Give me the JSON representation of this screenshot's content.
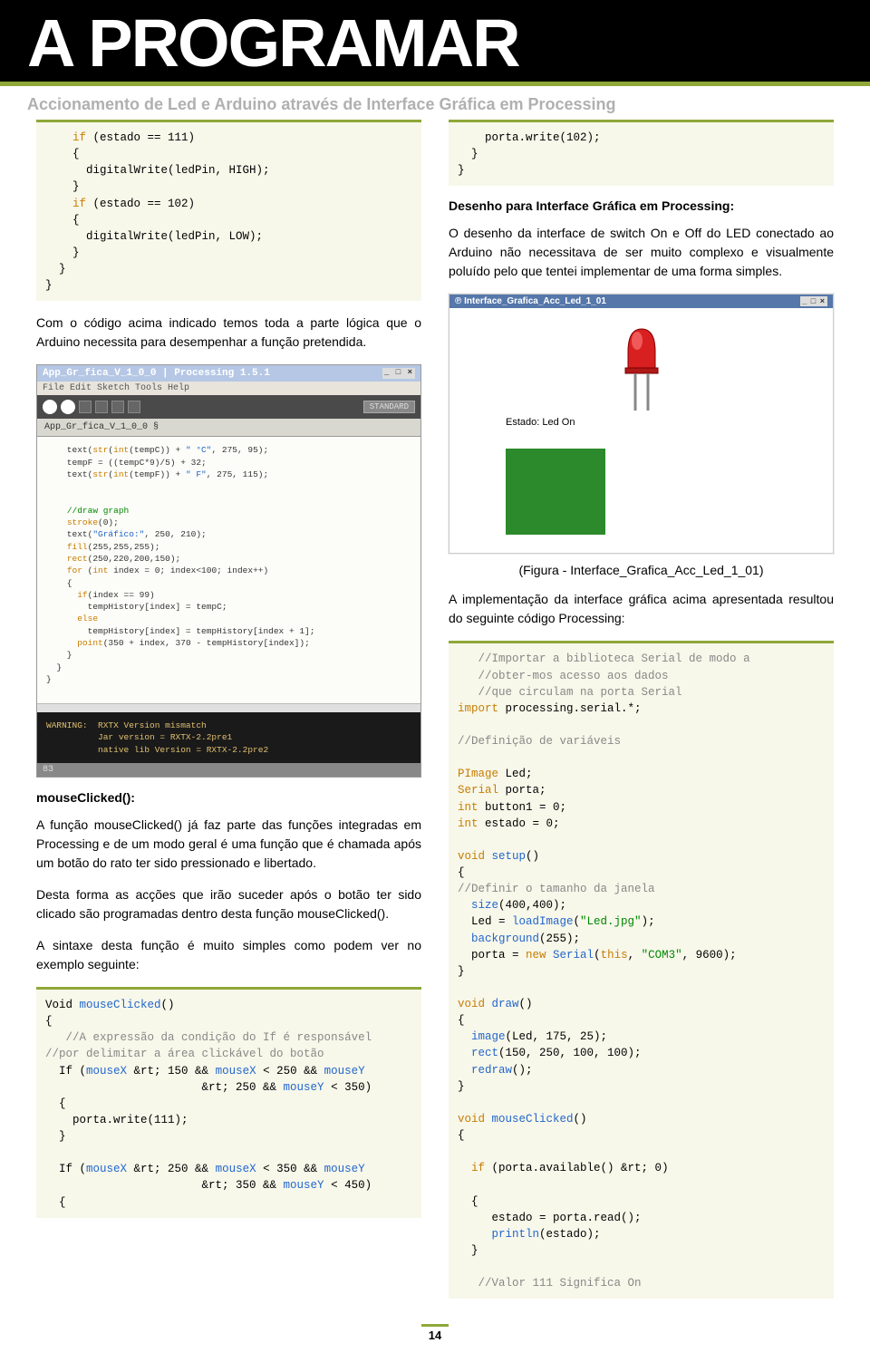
{
  "header": {
    "title": "A PROGRAMAR"
  },
  "subtitle": "Accionamento de Led e Arduino através de Interface Gráfica em Processing",
  "left": {
    "code1_html": "    <span class='kw'>if</span> (estado == 111)\n    {\n      digitalWrite(ledPin, HIGH);\n    }\n    <span class='kw'>if</span> (estado == 102)\n    {\n      digitalWrite(ledPin, LOW);\n    }\n  }\n}",
    "p1": "Com o código acima indicado temos toda a parte lógica que o Arduino necessita para desempenhar a função pretendida.",
    "ss1": {
      "window_title": "App_Gr_fica_V_1_0_0 | Processing 1.5.1",
      "menu": "File  Edit  Sketch  Tools  Help",
      "std": "STANDARD",
      "tab": "App_Gr_fica_V_1_0_0 §",
      "code_html": "    text(<span class='o'>str</span>(<span class='o'>int</span>(tempC)) + <span class='b'>\" °C\"</span>, 275, 95);\n    tempF = ((tempC*9)/5) + 32;\n    text(<span class='o'>str</span>(<span class='o'>int</span>(tempF)) + <span class='b'>\" F\"</span>, 275, 115);\n\n\n    <span class='g'>//draw graph</span>\n    <span class='o'>stroke</span>(0);\n    text(<span class='b'>\"Gráfico:\"</span>, 250, 210);\n    <span class='o'>fill</span>(255,255,255);\n    <span class='o'>rect</span>(250,220,200,150);\n    <span class='o'>for</span> (<span class='o'>int</span> index = 0; index&lt;100; index++)\n    {\n      <span class='o'>if</span>(index == 99)\n        tempHistory[index] = tempC;\n      <span class='o'>else</span>\n        tempHistory[index] = tempHistory[index + 1];\n      <span class='o'>point</span>(350 + index, 370 - tempHistory[index]);\n    }\n  }\n}",
      "console": "WARNING:  RXTX Version mismatch\n          Jar version = RXTX-2.2pre1\n          native lib Version = RXTX-2.2pre2",
      "status": "83"
    },
    "h_mouse": "mouseClicked():",
    "p2": "A função mouseClicked() já faz parte das funções integradas em Processing e de um modo geral é uma função que é chamada após um botão do rato ter sido pressionado e libertado.",
    "p3": "Desta forma as acções que irão suceder após o botão ter sido clicado são programadas dentro desta função mouseClicked().",
    "p4": "A sintaxe desta função é muito simples como podem ver no exemplo seguinte:",
    "code2_html": "Void <span class='fn'>mouseClicked</span>()\n{\n   <span class='cm'>//A expressão da condição do If é responsável</span>\n<span class='cm'>//por delimitar a área clickável do botão</span>\n  If (<span class='fn'>mouseX</span> &amp;rt; 150 &amp;&amp; <span class='fn'>mouseX</span> &lt; 250 &amp;&amp; <span class='fn'>mouseY</span>\n                       &amp;rt; 250 &amp;&amp; <span class='fn'>mouseY</span> &lt; 350)\n  {\n    porta.write(111);\n  }\n\n  If (<span class='fn'>mouseX</span> &amp;rt; 250 &amp;&amp; <span class='fn'>mouseX</span> &lt; 350 &amp;&amp; <span class='fn'>mouseY</span>\n                       &amp;rt; 350 &amp;&amp; <span class='fn'>mouseY</span> &lt; 450)\n  {"
  },
  "right": {
    "code1_html": "    porta.write(102);\n  }\n}",
    "h1": "Desenho para Interface Gráfica em Processing:",
    "p1": "O desenho da interface de switch On e Off  do LED conectado ao Arduino não necessitava de ser muito complexo e visualmente poluído pelo que tentei implementar de uma forma simples.",
    "ss2": {
      "window_title": "Interface_Grafica_Acc_Led_1_01",
      "label": "Estado: Led On"
    },
    "caption": "(Figura - Interface_Grafica_Acc_Led_1_01)",
    "p2": "A implementação da interface gráfica acima apresentada resultou do seguinte código Processing:",
    "code2_html": "   <span class='cm'>//Importar a biblioteca Serial de modo a</span>\n   <span class='cm'>//obter-mos acesso aos dados</span>\n   <span class='cm'>//que circulam na porta Serial</span>\n<span class='kw'>import</span> processing.serial.*;\n\n<span class='cm'>//Definição de variáveis</span>\n\n<span class='ty'>PImage</span> Led;\n<span class='ty'>Serial</span> porta;\n<span class='kw'>int</span> button1 = 0;\n<span class='kw'>int</span> estado = 0;\n\n<span class='kw'>void</span> <span class='fn'>setup</span>()\n{\n<span class='cm'>//Definir o tamanho da janela</span>\n  <span class='fn'>size</span>(400,400);\n  Led = <span class='fn'>loadImage</span>(<span class='str'>\"Led.jpg\"</span>);\n  <span class='fn'>background</span>(255);\n  porta = <span class='kw'>new</span> <span class='fn'>Serial</span>(<span class='kw'>this</span>, <span class='str'>\"COM3\"</span>, 9600);\n}\n\n<span class='kw'>void</span> <span class='fn'>draw</span>()\n{\n  <span class='fn'>image</span>(Led, 175, 25);\n  <span class='fn'>rect</span>(150, 250, 100, 100);\n  <span class='fn'>redraw</span>();\n}\n\n<span class='kw'>void</span> <span class='fn'>mouseClicked</span>()\n{\n\n  <span class='kw'>if</span> (porta.available() &amp;rt; 0)\n\n  {\n     estado = porta.read();\n     <span class='fn'>println</span>(estado);\n  }\n\n   <span class='cm'>//Valor 111 Significa On</span>"
  },
  "pagenum": "14"
}
